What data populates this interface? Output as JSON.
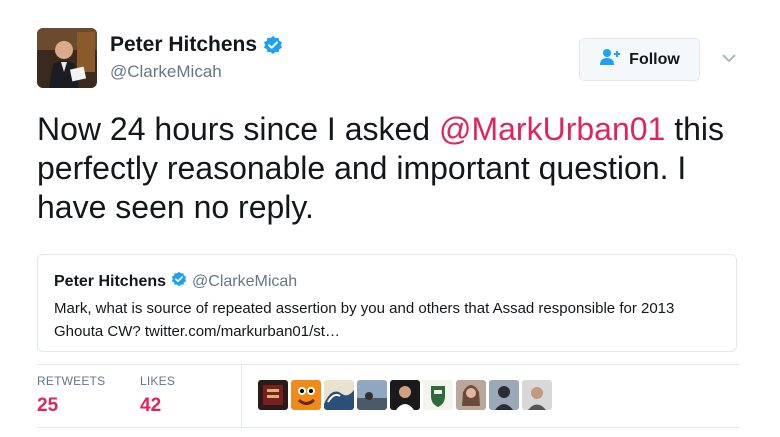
{
  "author": {
    "name": "Peter Hitchens",
    "handle": "@ClarkeMicah",
    "verified_icon": "verified-badge-icon"
  },
  "follow_button": {
    "label": "Follow",
    "icon": "add-person-icon"
  },
  "menu": {
    "icon": "chevron-down-icon"
  },
  "tweet": {
    "text_before": "Now 24 hours since I asked ",
    "mention": "@MarkUrban01",
    "text_after": " this perfectly reasonable and important question. I have seen no reply."
  },
  "quoted_tweet": {
    "name": "Peter Hitchens",
    "handle": "@ClarkeMicah",
    "text": "Mark, what is source of repeated assertion by you and others that Assad responsible for 2013 Ghouta CW? twitter.com/markurban01/st…"
  },
  "stats": {
    "retweets_label": "RETWEETS",
    "retweets_value": "25",
    "likes_label": "LIKES",
    "likes_value": "42"
  },
  "colors": {
    "accent": "#e0245e",
    "verified": "#1da1f2",
    "muted": "#657786",
    "border": "#e1e8ed"
  }
}
